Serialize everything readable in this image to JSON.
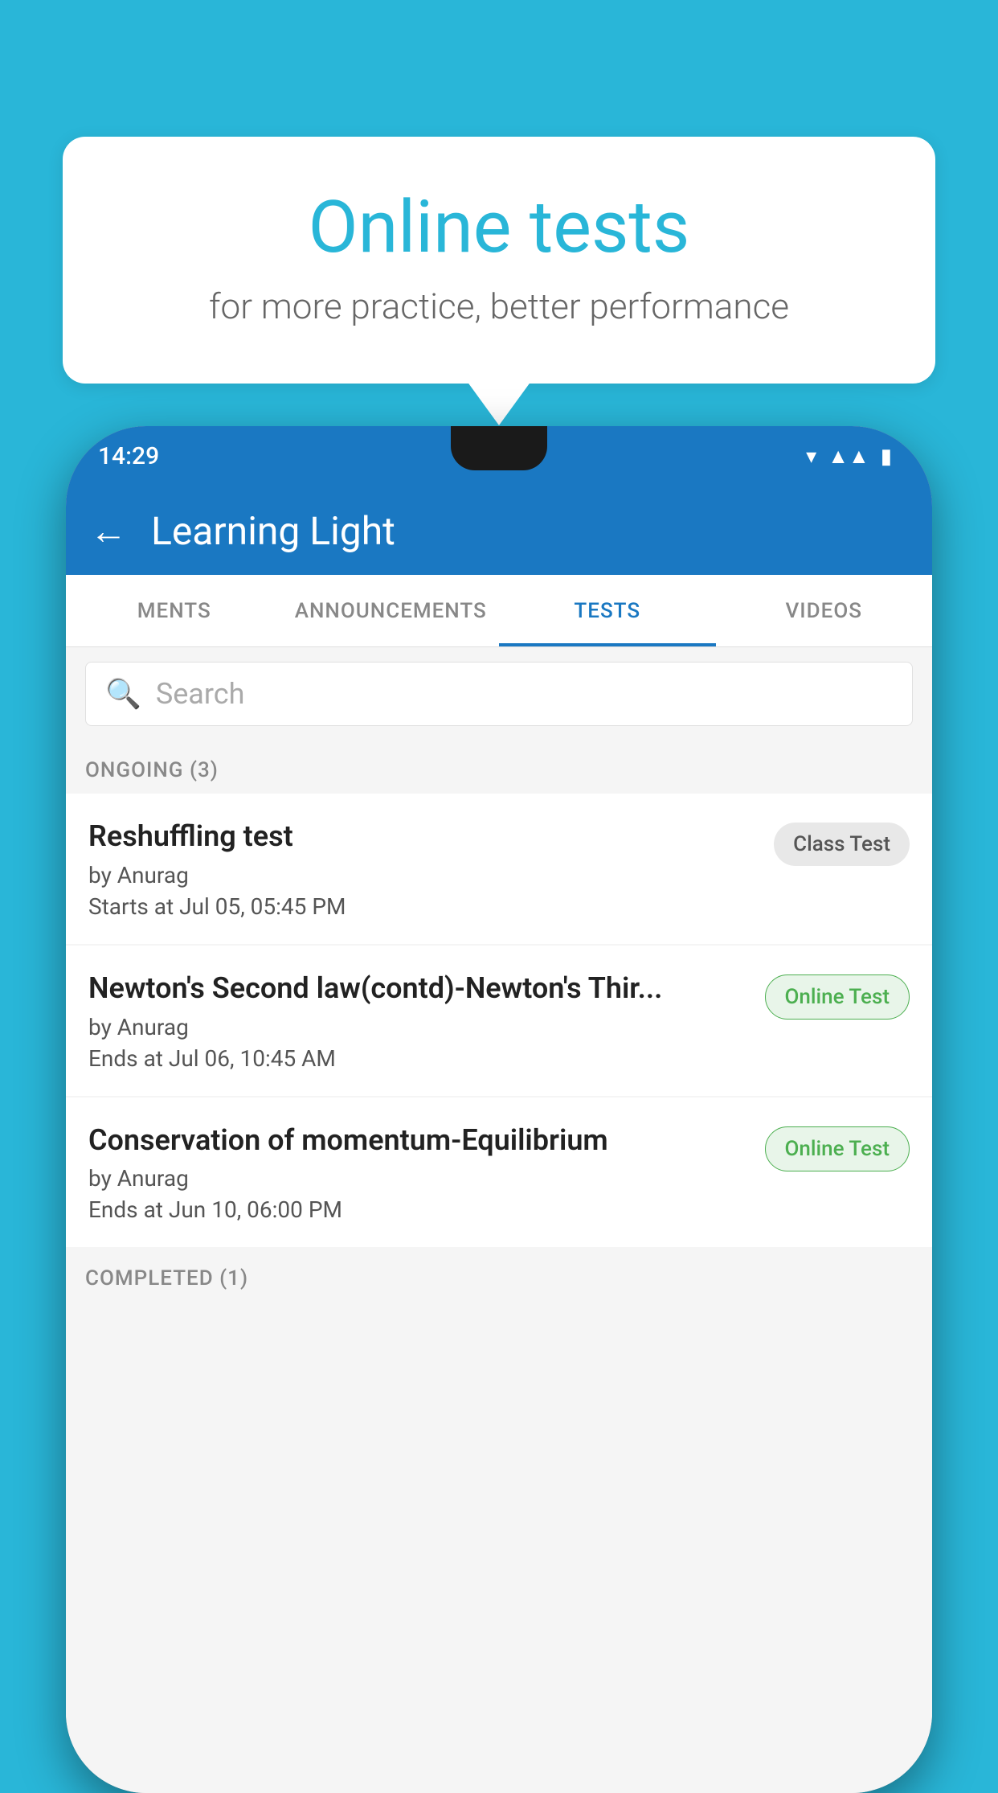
{
  "background_color": "#29b6d8",
  "speech_bubble": {
    "title": "Online tests",
    "subtitle": "for more practice, better performance"
  },
  "phone": {
    "status_bar": {
      "time": "14:29",
      "icons": [
        "wifi",
        "signal",
        "battery"
      ]
    },
    "app_header": {
      "title": "Learning Light",
      "back_label": "←"
    },
    "tabs": [
      {
        "label": "MENTS",
        "active": false
      },
      {
        "label": "ANNOUNCEMENTS",
        "active": false
      },
      {
        "label": "TESTS",
        "active": true
      },
      {
        "label": "VIDEOS",
        "active": false
      }
    ],
    "search": {
      "placeholder": "Search"
    },
    "ongoing_section": {
      "header": "ONGOING (3)",
      "items": [
        {
          "name": "Reshuffling test",
          "author": "by Anurag",
          "time_label": "Starts at",
          "time": "Jul 05, 05:45 PM",
          "badge": "Class Test",
          "badge_type": "class"
        },
        {
          "name": "Newton's Second law(contd)-Newton's Thir...",
          "author": "by Anurag",
          "time_label": "Ends at",
          "time": "Jul 06, 10:45 AM",
          "badge": "Online Test",
          "badge_type": "online"
        },
        {
          "name": "Conservation of momentum-Equilibrium",
          "author": "by Anurag",
          "time_label": "Ends at",
          "time": "Jun 10, 06:00 PM",
          "badge": "Online Test",
          "badge_type": "online"
        }
      ]
    },
    "completed_section": {
      "header": "COMPLETED (1)"
    }
  }
}
